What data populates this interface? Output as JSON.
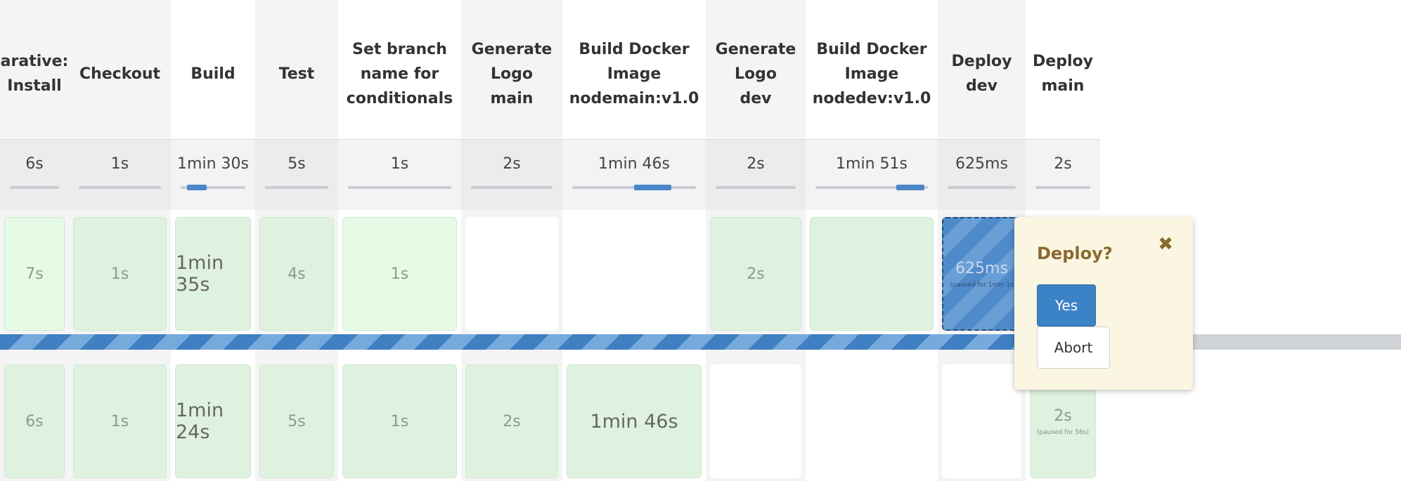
{
  "stages": [
    {
      "name": "arative:\n Install",
      "avg": "6s"
    },
    {
      "name": "Checkout",
      "avg": "1s"
    },
    {
      "name": "Build",
      "avg": "1min 30s"
    },
    {
      "name": "Test",
      "avg": "5s"
    },
    {
      "name": "Set branch\nname for\nconditionals",
      "avg": "1s"
    },
    {
      "name": "Generate\nLogo\nmain",
      "avg": "2s"
    },
    {
      "name": "Build Docker\nImage\nnodemain:v1.0",
      "avg": "1min 46s"
    },
    {
      "name": "Generate\nLogo\ndev",
      "avg": "2s"
    },
    {
      "name": "Build Docker\nImage\nnodedev:v1.0",
      "avg": "1min 51s"
    },
    {
      "name": "Deploy\ndev",
      "avg": "625ms"
    },
    {
      "name": "Deploy\nmain",
      "avg": "2s"
    }
  ],
  "runs": [
    {
      "cells": [
        {
          "state": "success",
          "duration": "7s"
        },
        {
          "state": "success",
          "duration": "1s"
        },
        {
          "state": "success",
          "duration": "1min 35s"
        },
        {
          "state": "success",
          "duration": "4s"
        },
        {
          "state": "success",
          "duration": "1s"
        },
        {
          "state": "empty",
          "duration": ""
        },
        {
          "state": "empty",
          "duration": ""
        },
        {
          "state": "success",
          "duration": "2s"
        },
        {
          "state": "success",
          "duration": ""
        },
        {
          "state": "running",
          "duration": "625ms",
          "note": "(paused for 1min 1s"
        },
        {
          "state": "empty",
          "duration": ""
        }
      ]
    },
    {
      "cells": [
        {
          "state": "success",
          "duration": "6s"
        },
        {
          "state": "success",
          "duration": "1s"
        },
        {
          "state": "success",
          "duration": "1min 24s"
        },
        {
          "state": "success",
          "duration": "5s"
        },
        {
          "state": "success",
          "duration": "1s"
        },
        {
          "state": "success",
          "duration": "2s"
        },
        {
          "state": "success",
          "duration": "1min 46s"
        },
        {
          "state": "empty",
          "duration": ""
        },
        {
          "state": "empty",
          "duration": ""
        },
        {
          "state": "empty",
          "duration": ""
        },
        {
          "state": "success",
          "duration": "2s",
          "note": "(paused for 56s)"
        }
      ]
    }
  ],
  "popover": {
    "title": "Deploy?",
    "close_icon": "✖",
    "yes_label": "Yes",
    "abort_label": "Abort"
  },
  "colors": {
    "success": "#dff2df",
    "running": "#4f8acb",
    "accent": "#3c82c6",
    "popover_title": "#8b6a2e"
  }
}
